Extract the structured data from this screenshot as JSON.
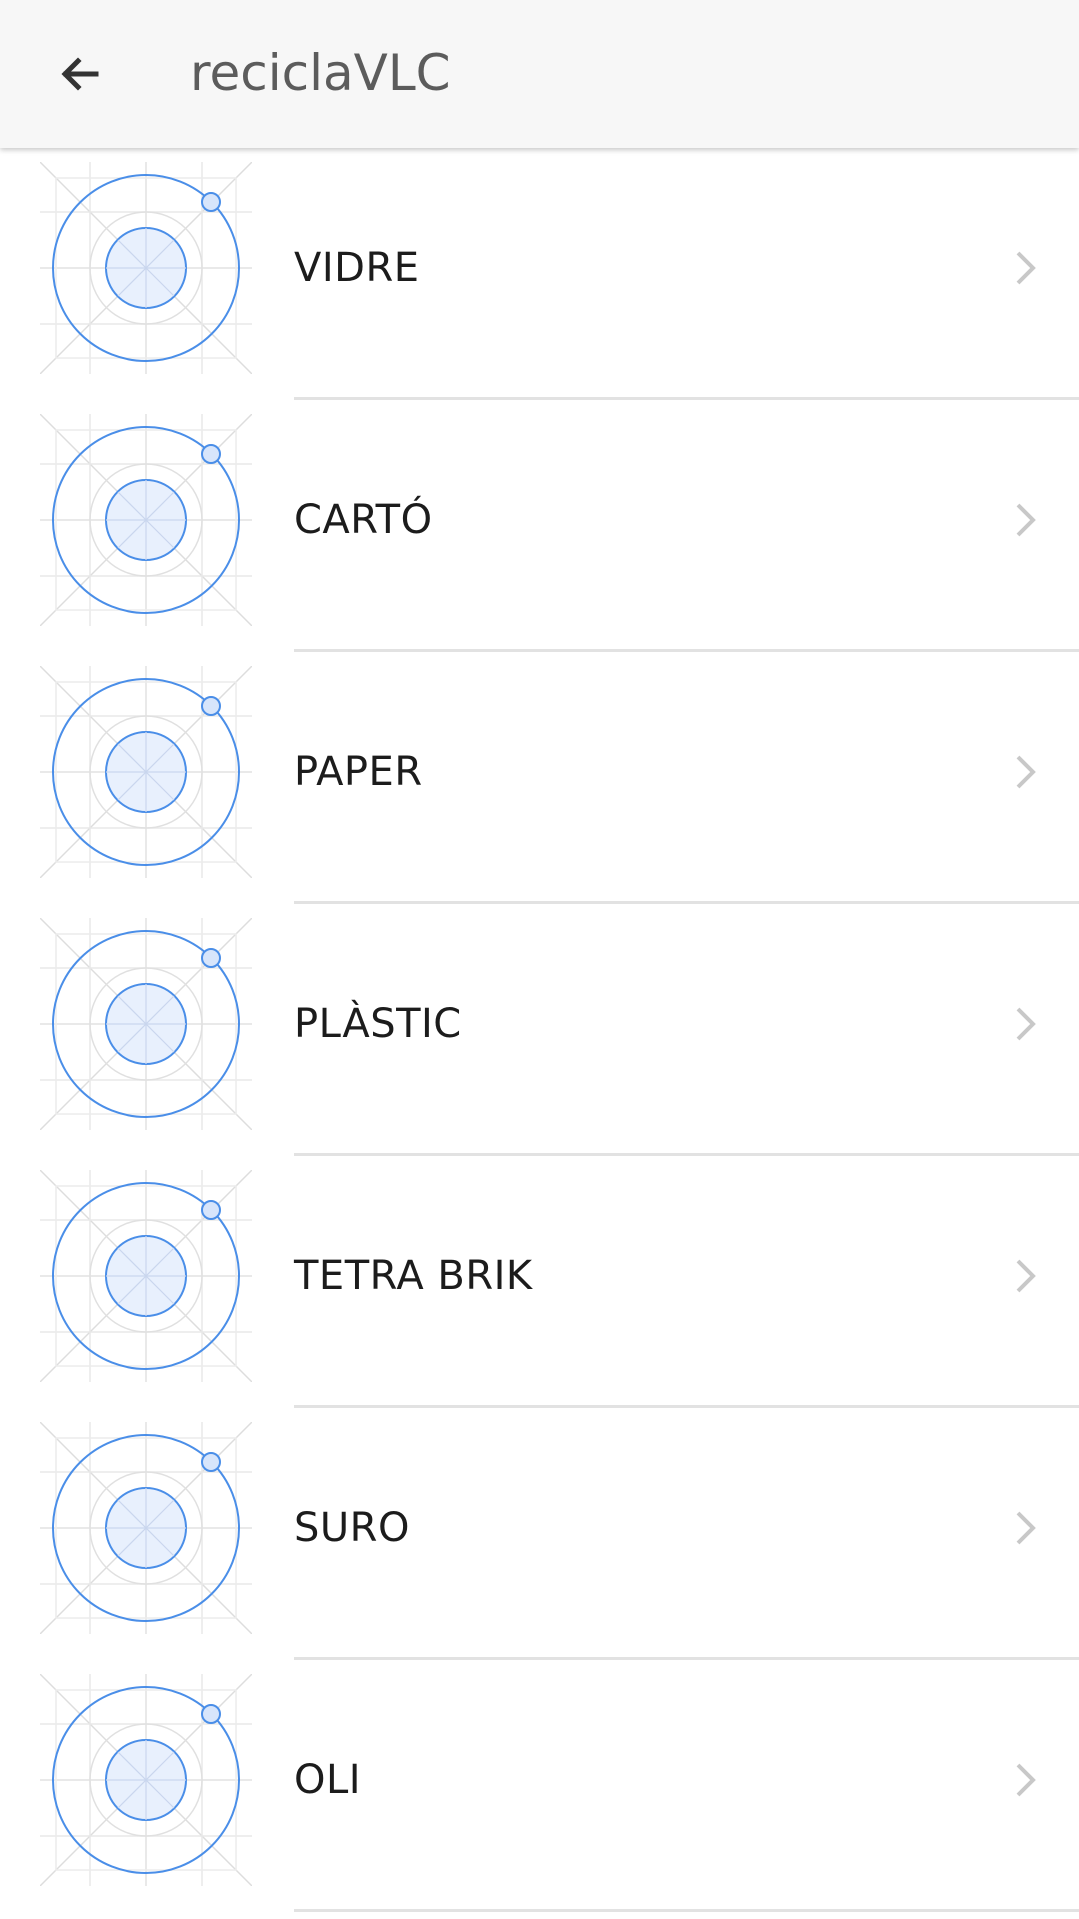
{
  "appbar": {
    "title": "reciclaVLC",
    "back_icon": "arrow-back-icon"
  },
  "colors": {
    "appbar_bg": "#f7f7f7",
    "placeholder_blue": "#4a8ee8",
    "placeholder_fill": "#e8f0fd",
    "divider": "#e2e2e2",
    "chevron": "#c8c8c8"
  },
  "items": [
    {
      "label": "VIDRE",
      "icon": "image-placeholder-icon"
    },
    {
      "label": "CARTÓ",
      "icon": "image-placeholder-icon"
    },
    {
      "label": "PAPER",
      "icon": "image-placeholder-icon"
    },
    {
      "label": "PLÀSTIC",
      "icon": "image-placeholder-icon"
    },
    {
      "label": "TETRA BRIK",
      "icon": "image-placeholder-icon"
    },
    {
      "label": "SURO",
      "icon": "image-placeholder-icon"
    },
    {
      "label": "OLI",
      "icon": "image-placeholder-icon"
    }
  ]
}
